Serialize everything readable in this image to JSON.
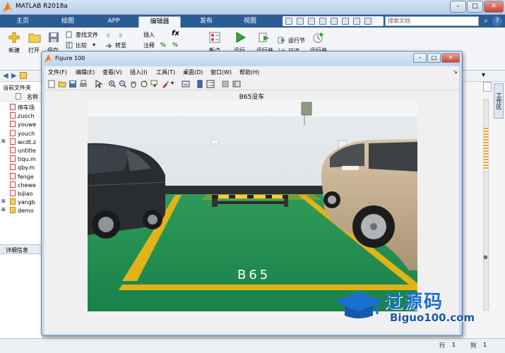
{
  "main_window": {
    "title": "MATLAB R2018a",
    "buttons": {
      "minimize": "–",
      "maximize": "□",
      "close": "✕"
    },
    "tabs": [
      {
        "label": "主页"
      },
      {
        "label": "绘图"
      },
      {
        "label": "APP"
      },
      {
        "label": "编辑器"
      },
      {
        "label": "发布"
      },
      {
        "label": "视图"
      }
    ],
    "active_tab": "编辑器",
    "search_placeholder": "搜索文档",
    "help_label": "?"
  },
  "ribbon": {
    "new_label": "新建",
    "open_label": "打开",
    "save_label": "保存",
    "find_file_label": "查找文件",
    "compare_label": "比较",
    "goto_label": "转至",
    "insert_label": "插入",
    "comment_label": "注释",
    "breakpoint_label": "断点",
    "run_label": "运行",
    "run_advance_label": "运行并",
    "run_section_label": "运行节",
    "advance_label": "前进",
    "run_and_label": "运行并"
  },
  "left_pane": {
    "current_folder_label": "当前文件夹",
    "name_header": "名称",
    "files": [
      "停车场",
      "zuoch",
      "youwe",
      "youch",
      "wcdt.z",
      "untitle",
      "tiqu.m",
      "qby.m",
      "fenge",
      "chewe",
      "bijiao",
      "yangb",
      "demo"
    ],
    "details_label": "详细信息"
  },
  "right_pane": {
    "workspace_label": "工作区"
  },
  "status_bar": {
    "row_label": "行",
    "row_value": "1",
    "col_label": "列",
    "col_value": "1"
  },
  "figure": {
    "title": "Figure 100",
    "menu": [
      "文件(F)",
      "编辑(E)",
      "查看(V)",
      "插入(I)",
      "工具(T)",
      "桌面(D)",
      "窗口(W)",
      "帮助(H)"
    ],
    "axes_title": "B65没车",
    "slot_label": "B65"
  },
  "watermark": {
    "text": "过源码",
    "url": "Biguo100.com"
  },
  "colors": {
    "tab_bar": "#2b5c96",
    "floor_green": "#1f8a4c",
    "line_yellow": "#e0b419",
    "watermark_blue": "#1b6fd0"
  }
}
